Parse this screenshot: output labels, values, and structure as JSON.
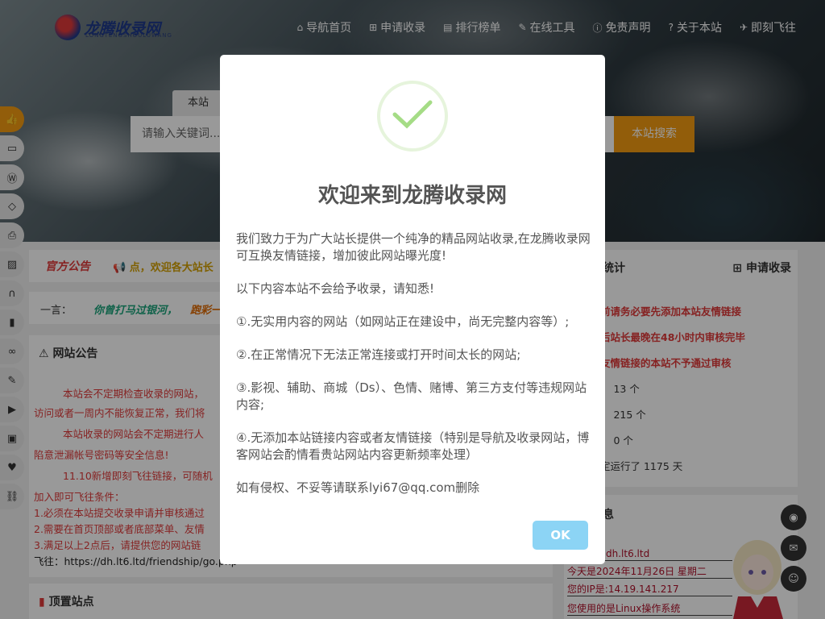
{
  "header": {
    "logo_text": "龙腾收录网",
    "logo_sub": "LONGTENGSHOULUWANG",
    "nav": [
      {
        "icon": "home-icon",
        "glyph": "⌂",
        "label": "导航首页"
      },
      {
        "icon": "plus-square-icon",
        "glyph": "⊞",
        "label": "申请收录"
      },
      {
        "icon": "chart-icon",
        "glyph": "▤",
        "label": "排行榜单"
      },
      {
        "icon": "wrench-icon",
        "glyph": "✎",
        "label": "在线工具"
      },
      {
        "icon": "info-icon",
        "glyph": "ⓘ",
        "label": "免责声明"
      },
      {
        "icon": "question-icon",
        "glyph": "?",
        "label": "关于本站"
      },
      {
        "icon": "plane-icon",
        "glyph": "✈",
        "label": "即刻飞往"
      }
    ]
  },
  "search": {
    "tab": "本站",
    "placeholder": "请输入关键词...",
    "button": "本站搜索"
  },
  "side_float": [
    "thumbs-up-icon",
    "monitor-icon",
    "wordpress-icon",
    "diamond-icon",
    "print-icon",
    "image-icon",
    "headphones-icon",
    "book-icon",
    "link-icon",
    "brush-icon",
    "video-icon",
    "save-icon",
    "like-icon",
    "chain-icon"
  ],
  "notice": {
    "title": "官方公告",
    "text": "📢 点，欢迎各大站长"
  },
  "yiyan": {
    "label": "一言：",
    "text1": "你曾打马过银河，",
    "text2": "跑彩一"
  },
  "gonggao": {
    "title": "网站公告",
    "lines": [
      "本站会不定期检查收录的网站，",
      "访问或者一周内不能恢复正常，我们将",
      "本站收录的网站会不定期进行人",
      "陷意泄漏帐号密码等安全信息!",
      "11.10新增即刻飞往链接，可随机",
      "加入即可飞往条件：",
      "1.必须在本站提交收录申请并审核通过",
      "2.需要在首页顶部或者底部菜单、友情",
      "3.满足以上2点后，请提供您的网站链",
      "飞往：https://dh.lt6.ltd/friendship/go.php"
    ]
  },
  "pinned": {
    "title": "顶置站点"
  },
  "stats": {
    "title": "本站统计",
    "add": "申请收录",
    "lines": [
      "收录前请务必要先添加本站友情链接",
      "加站后站长最晚在48小时内审核完毕",
      "本站友情链接的本站不予通过审核",
      "分类：  13 个",
      "站点：  215 个",
      "站点：  0 个",
      "已稳定运行了 1175 天"
    ]
  },
  "visitor": {
    "title": "访信息",
    "lines": [
      "到本站：dh.lt6.ltd",
      "今天是2024年11月26日  星期二",
      "您的IP是:14.19.141.217",
      "您使用的是Linux操作系统"
    ]
  },
  "float_buttons": [
    "qq-icon",
    "mail-icon",
    "wechat-icon"
  ],
  "modal": {
    "title": "欢迎来到龙腾收录网",
    "paragraphs": [
      "我们致力于为广大站长提供一个纯净的精品网站收录,在龙腾收录网可互换友情链接，增加彼此网站曝光度!",
      "以下内容本站不会给予收录，请知悉!",
      "①.无实用内容的网站（如网站正在建设中，尚无完整内容等）;",
      "②.在正常情况下无法正常连接或打开时间太长的网站;",
      "③.影视、辅助、商城（Ds）、色情、赌博、第三方支付等违规网站内容;",
      "④.无添加本站链接内容或者友情链接（特别是导航及收录网站，博客网站会酌情看贵站网站内容更新频率处理）",
      "如有侵权、不妥等请联系lyi67@qq.com删除"
    ],
    "ok": "OK"
  }
}
